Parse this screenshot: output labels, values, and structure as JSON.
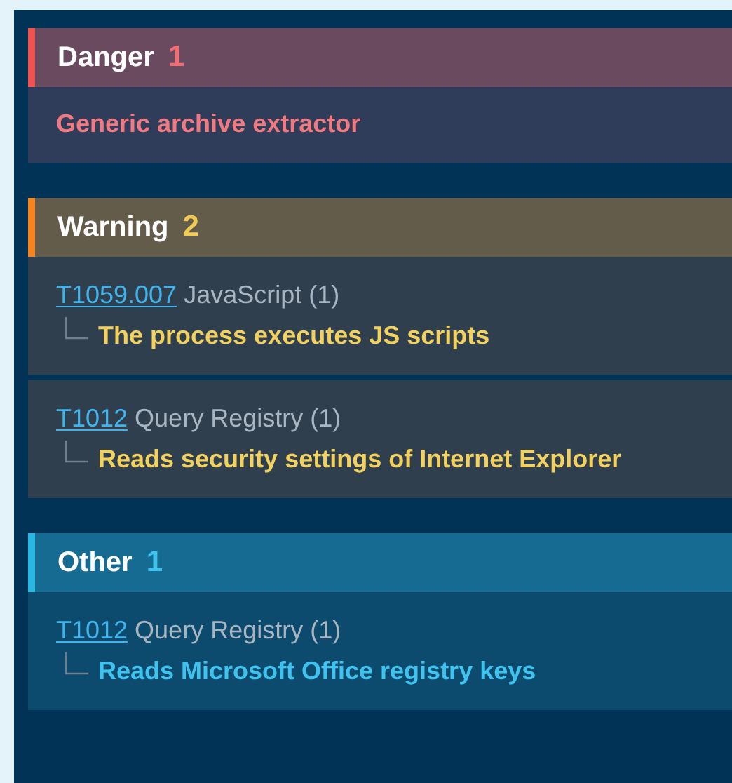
{
  "sections": [
    {
      "kind": "danger",
      "title": "Danger",
      "count": "1",
      "entries": [
        {
          "kind": "signature",
          "text": "Generic archive extractor"
        }
      ]
    },
    {
      "kind": "warning",
      "title": "Warning",
      "count": "2",
      "entries": [
        {
          "kind": "technique",
          "id": "T1059.007",
          "name": "JavaScript (1)",
          "children": [
            {
              "text": "The process executes JS scripts"
            }
          ]
        },
        {
          "kind": "technique",
          "id": "T1012",
          "name": "Query Registry (1)",
          "children": [
            {
              "text": "Reads security settings of Internet Explorer"
            }
          ]
        }
      ]
    },
    {
      "kind": "other",
      "title": "Other",
      "count": "1",
      "entries": [
        {
          "kind": "technique",
          "id": "T1012",
          "name": "Query Registry (1)",
          "children": [
            {
              "text": "Reads Microsoft Office registry keys"
            }
          ]
        }
      ]
    }
  ]
}
